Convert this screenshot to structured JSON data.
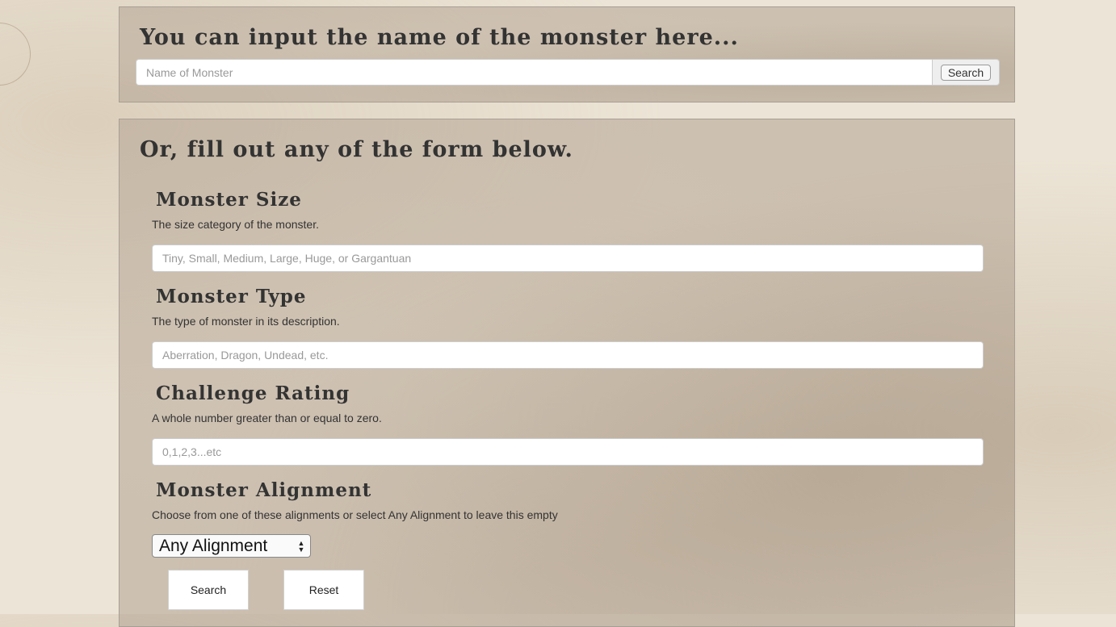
{
  "quick_search": {
    "heading": "You can input the name of the monster here...",
    "name_placeholder": "Name of Monster",
    "search_label": "Search"
  },
  "form": {
    "heading": "Or, fill out any of the form below.",
    "size": {
      "title": "Monster Size",
      "description": "The size category of the monster.",
      "placeholder": "Tiny, Small, Medium, Large, Huge, or Gargantuan"
    },
    "type": {
      "title": "Monster Type",
      "description": "The type of monster in its description.",
      "placeholder": "Aberration, Dragon, Undead, etc."
    },
    "challenge": {
      "title": "Challenge Rating",
      "description": "A whole number greater than or equal to zero.",
      "placeholder": "0,1,2,3...etc"
    },
    "alignment": {
      "title": "Monster Alignment",
      "description": "Choose from one of these alignments or select Any Alignment to leave this empty",
      "selected": "Any Alignment"
    },
    "search_label": "Search",
    "reset_label": "Reset"
  }
}
